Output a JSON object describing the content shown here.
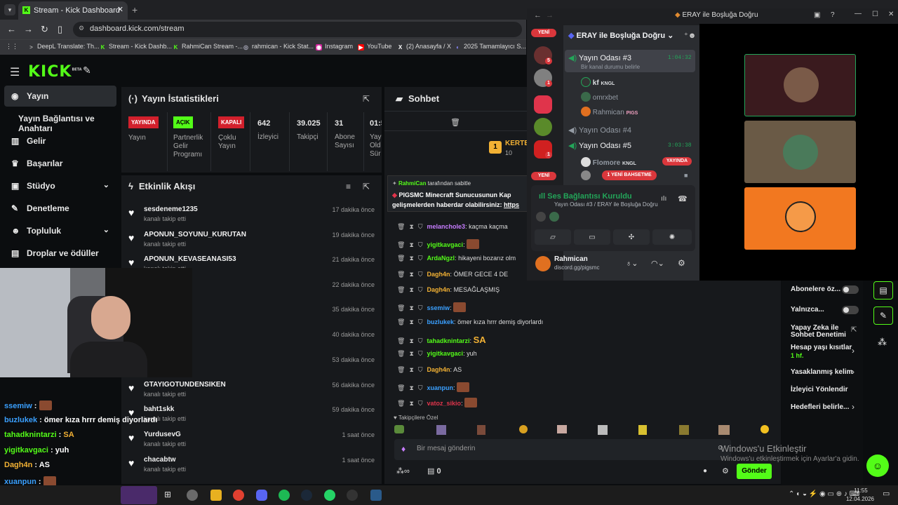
{
  "browser": {
    "tab_title": "Stream - Kick Dashboard",
    "url": "dashboard.kick.com/stream",
    "bookmarks": [
      "DeepL Translate: Th...",
      "Stream - Kick Dashb...",
      "RahmiCan Stream -...",
      "rahmican - Kick Stat...",
      "Instagram",
      "YouTube",
      "(2) Anasayfa / X",
      "2025 Tamamlayıcı S..."
    ]
  },
  "kick": {
    "logo": "KICK",
    "logo_sup": "BETA",
    "sidebar": [
      {
        "label": "Yayın",
        "icon": "broadcast-icon"
      },
      {
        "label": "Yayın Bağlantısı ve Anahtarı",
        "icon": ""
      },
      {
        "label": "Gelir",
        "icon": "chart-icon"
      },
      {
        "label": "Başarılar",
        "icon": "trophy-icon"
      },
      {
        "label": "Stüdyo",
        "icon": "studio-icon"
      },
      {
        "label": "Denetleme",
        "icon": "wrench-icon"
      },
      {
        "label": "Topluluk",
        "icon": "people-icon"
      },
      {
        "label": "Droplar ve ödüller",
        "icon": "gift-icon"
      }
    ],
    "stats": {
      "title": "Yayın İstatistikleri",
      "cols": [
        {
          "badge": "YAYINDA",
          "badge_color": "#d2202c",
          "label": "Yayın"
        },
        {
          "badge": "AÇIK",
          "badge_color": "#53fc18",
          "label": "Partnerlik Gelir Programı"
        },
        {
          "badge": "KAPALI",
          "badge_color": "#d2202c",
          "label": "Çoklu Yayın"
        },
        {
          "value": "642",
          "label": "İzleyici"
        },
        {
          "value": "39.025",
          "label": "Takipçi"
        },
        {
          "value": "31",
          "label": "Abone Sayısı"
        },
        {
          "value": "01:5",
          "label": "Yay Old Sür"
        }
      ]
    },
    "activity": {
      "title": "Etkinlik Akışı",
      "rows": [
        {
          "name": "sesdeneme1235",
          "sub": "kanalı takip etti",
          "time": "17 dakika önce"
        },
        {
          "name": "APONUN_SOYUNU_KURUTAN",
          "sub": "kanalı takip etti",
          "time": "19 dakika önce"
        },
        {
          "name": "APONUN_KEVASEANASI53",
          "sub": "kanalı takip etti",
          "time": "21 dakika önce"
        },
        {
          "name": "",
          "sub": "",
          "time": "22 dakika önce"
        },
        {
          "name": "",
          "sub": "",
          "time": "35 dakika önce"
        },
        {
          "name": "",
          "sub": "",
          "time": "40 dakika önce"
        },
        {
          "name": "",
          "sub": "",
          "time": "53 dakika önce"
        },
        {
          "name": "GTAYIGOTUNDENSIKEN",
          "sub": "kanalı takip etti",
          "time": "56 dakika önce"
        },
        {
          "name": "baht1skk",
          "sub": "kanalı takip etti",
          "time": "59 dakika önce"
        },
        {
          "name": "YurdusevG",
          "sub": "kanalı takip etti",
          "time": "1 saat önce"
        },
        {
          "name": "chacabtw",
          "sub": "kanalı takip etti",
          "time": "1 saat önce"
        }
      ]
    },
    "chat": {
      "title": "Sohbet",
      "top_user": "KERTE",
      "top_count": "10",
      "pinned_by": "RahmiCan",
      "pinned_suffix": "tarafından sabitle",
      "pinned_text": "PIGSMC Minecraft Sunucusunun Kap",
      "pinned_text2": "gelişmelerden haberdar olabilirsiniz:",
      "pinned_link": "https",
      "messages": [
        {
          "user": "melanchole3",
          "color": "#c77dff",
          "text": "kaçma kaçma"
        },
        {
          "user": "yigitkavgaci",
          "color": "#53fc18",
          "text": ""
        },
        {
          "user": "ArdaNgzl",
          "color": "#53fc18",
          "text": "hikayeni bozarız olm"
        },
        {
          "user": "Dagh4n",
          "color": "#f2b134",
          "text": "ÖMER GECE 4 DE"
        },
        {
          "user": "Dagh4n",
          "color": "#f2b134",
          "text": "MESAĞLAŞMIŞ"
        },
        {
          "user": "ssemiw",
          "color": "#3aa0ff",
          "text": ""
        },
        {
          "user": "buzlukek",
          "color": "#3aa0ff",
          "text": "ömer kıza hrrr demiş diyorlardı"
        },
        {
          "user": "tahadknintarzi",
          "color": "#53fc18",
          "text": "SA"
        },
        {
          "user": "yigitkavgaci",
          "color": "#53fc18",
          "text": "yuh"
        },
        {
          "user": "Dagh4n",
          "color": "#f2b134",
          "text": "AS"
        },
        {
          "user": "xuanpun",
          "color": "#3aa0ff",
          "text": ""
        },
        {
          "user": "vatoz_sikio",
          "color": "#e0344b",
          "text": ""
        }
      ],
      "followers_only": "Takipçilere Özel",
      "input_placeholder": "Bir mesaj gönderin",
      "points": "0",
      "send": "Gönder"
    },
    "chat_settings": [
      "Abonelere öz...",
      "Yalnızca...",
      "Yapay Zeka ile Sohbet Denetimi",
      "Hesap yaşı kısıtlar",
      "1 hf.",
      "Yasaklanmış kelim",
      "İzleyici Yönlendir",
      "Hedefleri belirle..."
    ]
  },
  "overlay_chat": [
    {
      "user": "ssemiw",
      "color": "#3aa0ff",
      "text": ""
    },
    {
      "user": "buzlukek",
      "color": "#3aa0ff",
      "text": "ömer kıza hrrr demiş diyorlardı"
    },
    {
      "user": "tahadknintarzi",
      "color": "#53fc18",
      "text": "SA"
    },
    {
      "user": "yigitkavgaci",
      "color": "#53fc18",
      "text": "yuh"
    },
    {
      "user": "Dagh4n",
      "color": "#f2b134",
      "text": "AS"
    },
    {
      "user": "xuanpun",
      "color": "#3aa0ff",
      "text": ""
    },
    {
      "user": "vatoz_sikio",
      "color": "#e0344b",
      "text": ""
    }
  ],
  "discord": {
    "window_title": "ERAY ile Boşluğa Doğru",
    "server_name": "ERAY ile Boşluğa Doğru",
    "yeni": "YENİ",
    "channels": [
      {
        "name": "Yayın Odası #3",
        "timer": "1:04:32",
        "status": "Bir kanal durumu belirle"
      },
      {
        "name": "Yayın Odası #4",
        "timer": ""
      },
      {
        "name": "Yayın Odası #5",
        "timer": "3:03:38"
      }
    ],
    "users": [
      {
        "name": "kf",
        "tag": "KNGL"
      },
      {
        "name": "omrxbet",
        "tag": ""
      },
      {
        "name": "Rahmican",
        "tag": "PIGS"
      },
      {
        "name": "Flomore",
        "tag": "KNGL",
        "live": "YAYINDA"
      }
    ],
    "mention_pill": "1 YENİ BAHSETME",
    "voice_status": "Ses Bağlantısı Kuruldu",
    "voice_channel": "Yayın Odası #3 / ERAY ile Boşluğa Doğru",
    "me_name": "Rahmican",
    "me_status": "discord.gg/pigsmc"
  },
  "windows": {
    "watermark_title": "Windows'u Etkinleştir",
    "watermark_sub": "Windows'u etkinleştirmek için Ayarlar'a gidin.",
    "time": "11:55",
    "date": "12.04.2026"
  },
  "colors": {
    "accent": "#53fc18",
    "live": "#d2202c",
    "discord_green": "#23a559"
  }
}
